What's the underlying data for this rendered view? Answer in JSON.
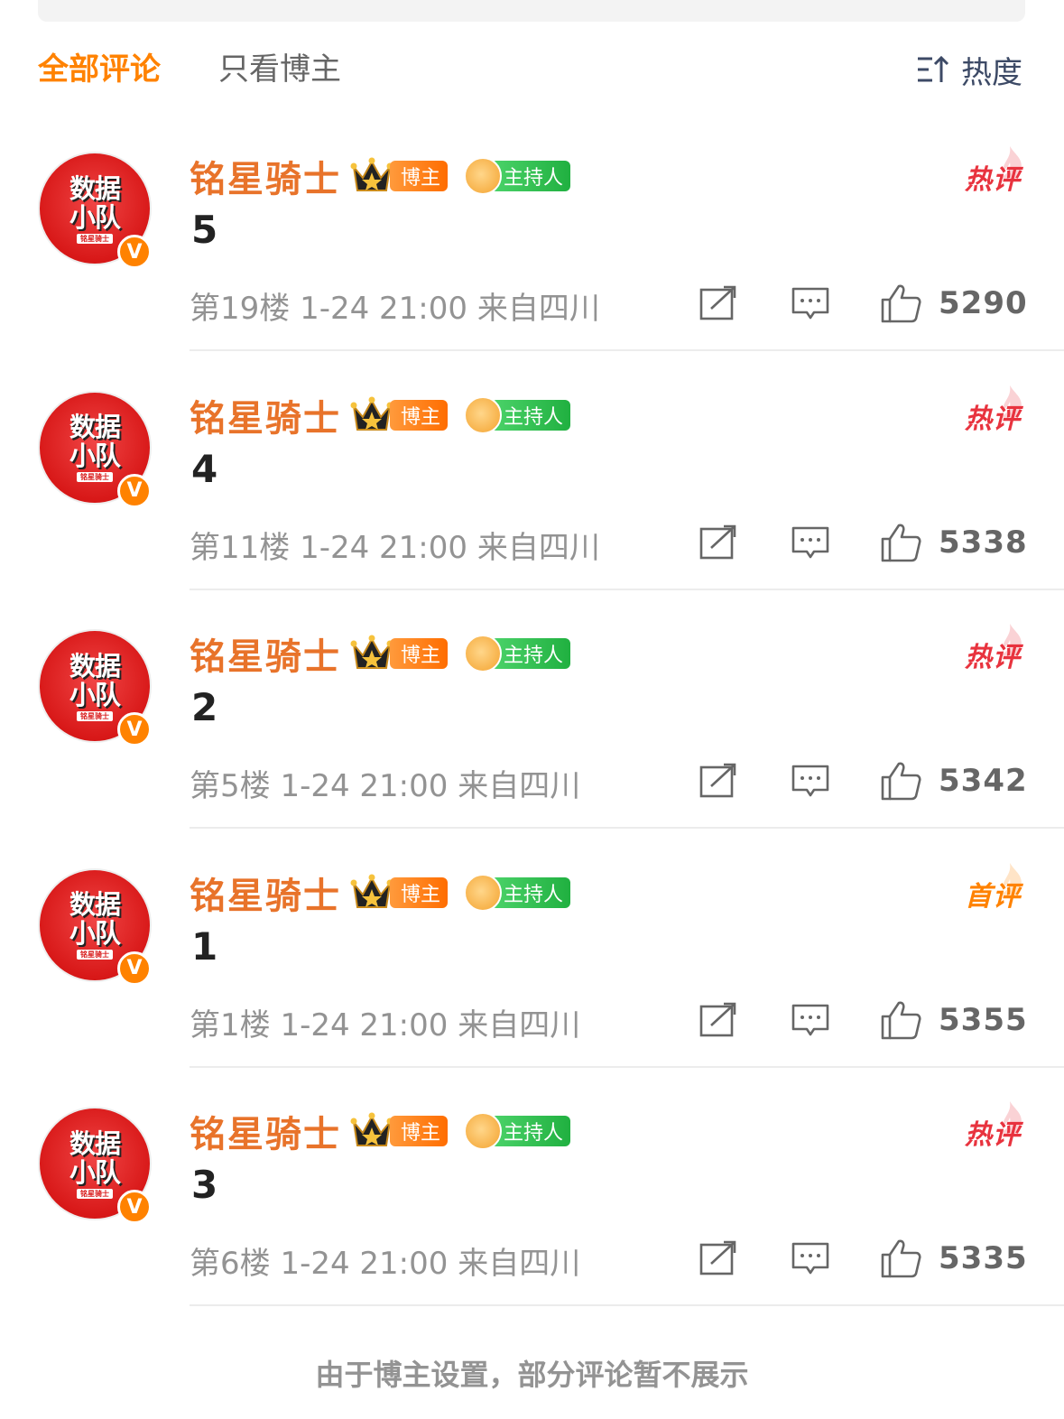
{
  "filter": {
    "tab_all": "全部评论",
    "tab_blogger": "只看博主",
    "sort_label": "热度"
  },
  "colors": {
    "accent": "#ff8200",
    "username": "#e8732a",
    "hot": "#e8333e",
    "meta": "#939393"
  },
  "comments": [
    {
      "username": "铭星骑士",
      "badge_blogger": "博主",
      "badge_host": "主持人",
      "tag": "热评",
      "tag_type": "hot",
      "content": "5",
      "meta": "第19楼 1-24 21:00  来自四川",
      "likes": "5290"
    },
    {
      "username": "铭星骑士",
      "badge_blogger": "博主",
      "badge_host": "主持人",
      "tag": "热评",
      "tag_type": "hot",
      "content": "4",
      "meta": "第11楼 1-24 21:00  来自四川",
      "likes": "5338"
    },
    {
      "username": "铭星骑士",
      "badge_blogger": "博主",
      "badge_host": "主持人",
      "tag": "热评",
      "tag_type": "hot",
      "content": "2",
      "meta": "第5楼 1-24 21:00  来自四川",
      "likes": "5342"
    },
    {
      "username": "铭星骑士",
      "badge_blogger": "博主",
      "badge_host": "主持人",
      "tag": "首评",
      "tag_type": "first",
      "content": "1",
      "meta": "第1楼 1-24 21:00  来自四川",
      "likes": "5355"
    },
    {
      "username": "铭星骑士",
      "badge_blogger": "博主",
      "badge_host": "主持人",
      "tag": "热评",
      "tag_type": "hot",
      "content": "3",
      "meta": "第6楼 1-24 21:00  来自四川",
      "likes": "5335"
    }
  ],
  "avatar": {
    "line1": "数据",
    "line2": "小队",
    "line3": "铭星骑士",
    "verified": "V"
  },
  "footer_note": "由于博主设置，部分评论暂不展示"
}
